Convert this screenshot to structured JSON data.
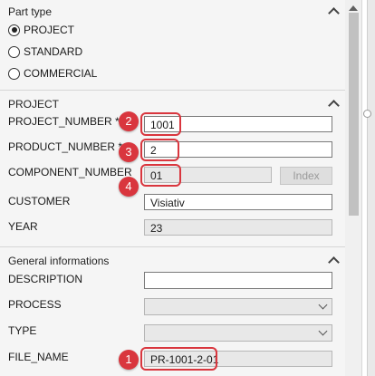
{
  "part_type": {
    "title": "Part type",
    "options": [
      {
        "label": "PROJECT",
        "checked": true
      },
      {
        "label": "STANDARD",
        "checked": false
      },
      {
        "label": "COMMERCIAL",
        "checked": false
      }
    ]
  },
  "project": {
    "title": "PROJECT",
    "project_number": {
      "label": "PROJECT_NUMBER *",
      "value": "1001"
    },
    "product_number": {
      "label": "PRODUCT_NUMBER *",
      "value": "2"
    },
    "component_number": {
      "label": "COMPONENT_NUMBER",
      "value": "01",
      "index_button": "Index"
    },
    "customer": {
      "label": "CUSTOMER",
      "value": "Visiativ"
    },
    "year": {
      "label": "YEAR",
      "value": "23"
    }
  },
  "general": {
    "title": "General informations",
    "description": {
      "label": "DESCRIPTION",
      "value": ""
    },
    "process": {
      "label": "PROCESS",
      "value": ""
    },
    "type": {
      "label": "TYPE",
      "value": ""
    },
    "file_name": {
      "label": "FILE_NAME",
      "value": "PR-1001-2-01"
    }
  },
  "markers": [
    "1",
    "2",
    "3",
    "4"
  ],
  "colors": {
    "marker": "#d9363e",
    "panel_bg": "#f5f5f5"
  }
}
